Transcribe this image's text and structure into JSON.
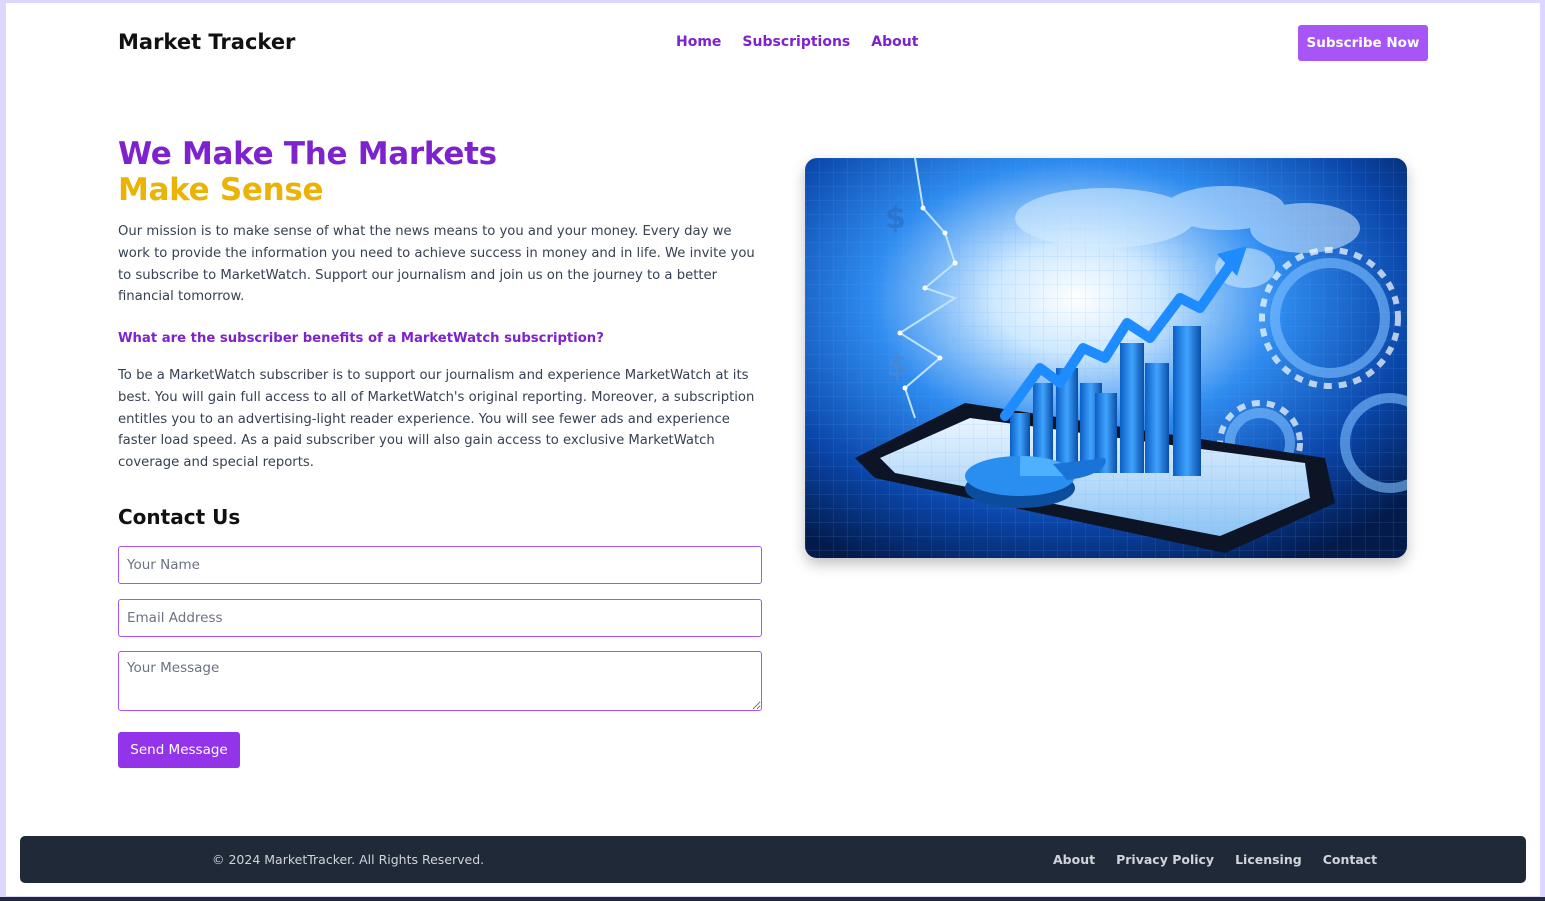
{
  "header": {
    "brand": "Market Tracker",
    "nav": [
      "Home",
      "Subscriptions",
      "About"
    ],
    "cta": "Subscribe Now"
  },
  "hero": {
    "title_line1": "We Make The Markets",
    "title_line2": "Make Sense",
    "mission": "Our mission is to make sense of what the news means to you and your money. Every day we work to provide the information you need to achieve success in money and in life. We invite you to subscribe to MarketWatch. Support our journalism and join us on the journey to a better financial tomorrow.",
    "benefits_question": "What are the subscriber benefits of a MarketWatch subscription?",
    "benefits_answer": "To be a MarketWatch subscriber is to support our journalism and experience MarketWatch at its best. You will gain full access to all of MarketWatch's original reporting. Moreover, a subscription entitles you to an advertising-light reader experience. You will see fewer ads and experience faster load speed. As a paid subscriber you will also gain access to exclusive MarketWatch coverage and special reports.",
    "image_description_icon": "market-chart-illustration"
  },
  "contact": {
    "title": "Contact Us",
    "name_placeholder": "Your Name",
    "email_placeholder": "Email Address",
    "message_placeholder": "Your Message",
    "submit_label": "Send Message"
  },
  "footer": {
    "copyright": "© 2024 MarketTracker. All Rights Reserved.",
    "links": [
      "About",
      "Privacy Policy",
      "Licensing",
      "Contact"
    ]
  },
  "colors": {
    "primary": "#7e22ce",
    "accent": "#eab308",
    "button": "#a855f7",
    "footer_bg": "#1f2937"
  }
}
